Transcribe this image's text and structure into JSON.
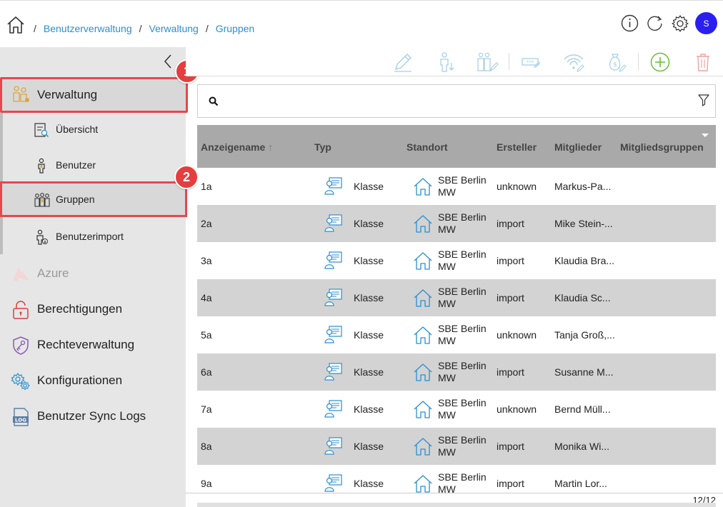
{
  "breadcrumb": {
    "separator": "/",
    "items": [
      "Benutzerverwaltung",
      "Verwaltung",
      "Gruppen"
    ]
  },
  "header": {
    "icons": [
      "info-icon",
      "refresh-icon",
      "gear-icon"
    ],
    "avatar_initial": "S"
  },
  "sidebar": {
    "main_items": [
      {
        "label": "Verwaltung",
        "icon": "users-admin-icon"
      },
      {
        "label": "Azure",
        "icon": "azure-icon"
      },
      {
        "label": "Berechtigungen",
        "icon": "lock-open-icon"
      },
      {
        "label": "Rechteverwaltung",
        "icon": "shield-key-icon"
      },
      {
        "label": "Konfigurationen",
        "icon": "gears-icon"
      },
      {
        "label": "Benutzer Sync Logs",
        "icon": "log-icon"
      }
    ],
    "sub_items": [
      {
        "label": "Übersicht",
        "icon": "overview-icon"
      },
      {
        "label": "Benutzer",
        "icon": "user-icon"
      },
      {
        "label": "Gruppen",
        "icon": "group-icon"
      },
      {
        "label": "Benutzerimport",
        "icon": "user-import-icon"
      }
    ]
  },
  "annotations": {
    "badge1": "1",
    "badge2": "2"
  },
  "colors": {
    "accent": "#2a8fd0",
    "highlight_border": "#e5484d",
    "avatar": "#2b1ff0",
    "add": "#6bbf3a",
    "delete": "#f08a8a"
  },
  "toolbar": {
    "icons": [
      "edit-icon",
      "user-download-icon",
      "group-edit-icon",
      "password-icon",
      "wifi-edit-icon",
      "money-bag-icon",
      "add-icon",
      "delete-icon"
    ]
  },
  "search": {
    "placeholder": ""
  },
  "table": {
    "columns": [
      "Anzeigename",
      "Typ",
      "Standort",
      "Ersteller",
      "Mitglieder",
      "Mitgliedsgruppen"
    ],
    "rows": [
      {
        "name": "1a",
        "typ": "Klasse",
        "standort": "SBE Berlin MW",
        "ersteller": "unknown",
        "mitglieder": "Markus-Pa..."
      },
      {
        "name": "2a",
        "typ": "Klasse",
        "standort": "SBE Berlin MW",
        "ersteller": "import",
        "mitglieder": "Mike Stein-..."
      },
      {
        "name": "3a",
        "typ": "Klasse",
        "standort": "SBE Berlin MW",
        "ersteller": "import",
        "mitglieder": "Klaudia Bra..."
      },
      {
        "name": "4a",
        "typ": "Klasse",
        "standort": "SBE Berlin MW",
        "ersteller": "import",
        "mitglieder": "Klaudia Sc..."
      },
      {
        "name": "5a",
        "typ": "Klasse",
        "standort": "SBE Berlin MW",
        "ersteller": "unknown",
        "mitglieder": "Tanja Groß,..."
      },
      {
        "name": "6a",
        "typ": "Klasse",
        "standort": "SBE Berlin MW",
        "ersteller": "import",
        "mitglieder": "Susanne M..."
      },
      {
        "name": "7a",
        "typ": "Klasse",
        "standort": "SBE Berlin MW",
        "ersteller": "unknown",
        "mitglieder": "Bernd Müll..."
      },
      {
        "name": "8a",
        "typ": "Klasse",
        "standort": "SBE Berlin MW",
        "ersteller": "import",
        "mitglieder": "Monika Wi..."
      },
      {
        "name": "9a",
        "typ": "Klasse",
        "standort": "SBE Berlin MW",
        "ersteller": "import",
        "mitglieder": "Martin Lor..."
      }
    ]
  },
  "pager": {
    "text": "12/12"
  }
}
